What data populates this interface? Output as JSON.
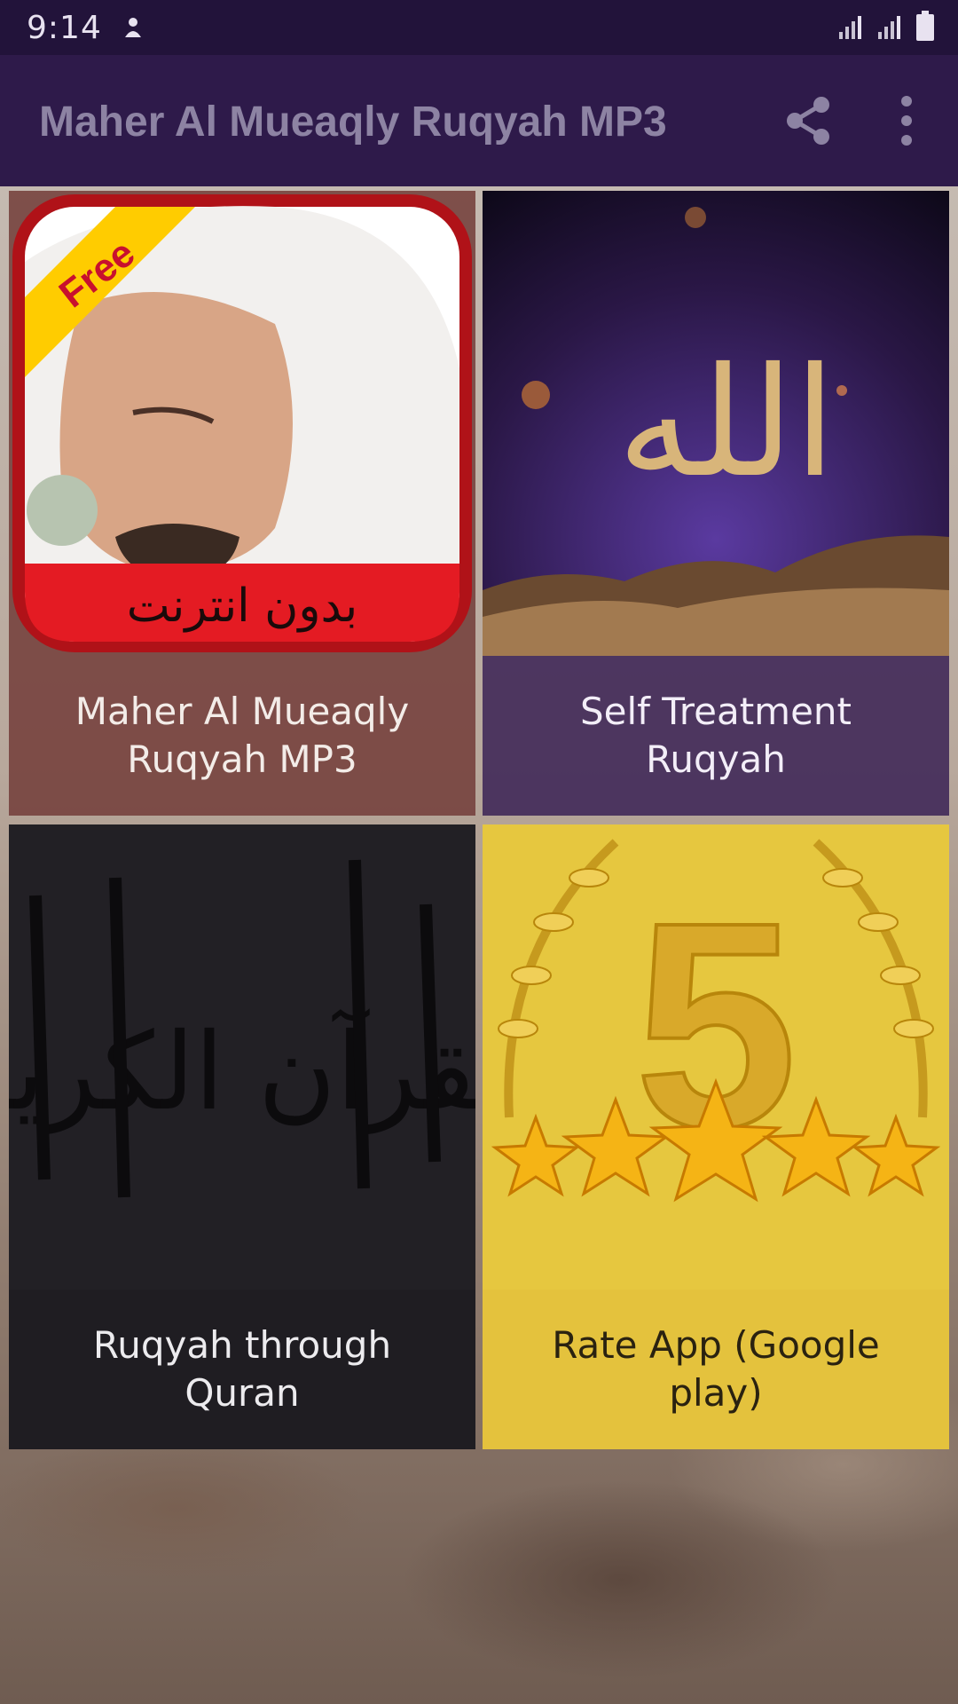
{
  "status_bar": {
    "time": "9:14"
  },
  "app_bar": {
    "title": "Maher Al Mueaqly Ruqyah MP3"
  },
  "tiles": [
    {
      "label": "Maher Al Mueaqly Ruqyah MP3",
      "badge": "Free",
      "banner_text": "بدون انترنت"
    },
    {
      "label": "Self Treatment Ruqyah",
      "calligraphy": "الله"
    },
    {
      "label": "Ruqyah through Quran",
      "calligraphy": "القرآن الكريم"
    },
    {
      "label": "Rate App (Google play)",
      "big_number": "5"
    }
  ],
  "colors": {
    "status_bar": "#22133a",
    "app_bar": "#2e1a4a",
    "title_text": "#8d83a3",
    "tile_gold": "#e4c23d"
  }
}
